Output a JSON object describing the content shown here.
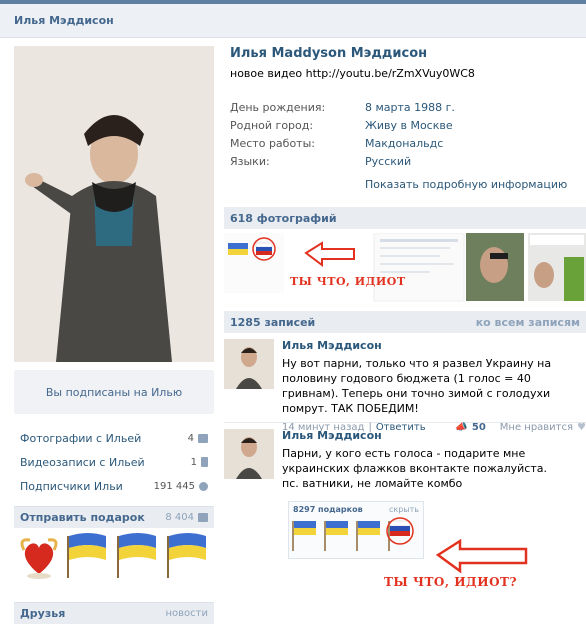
{
  "header": {
    "title": "Илья Мэддисон"
  },
  "profile": {
    "name": "Илья Maddyson Мэддисон",
    "status": "новое видео http://youtu.be/rZmXVuy0WC8",
    "info": [
      {
        "label": "День рождения:",
        "value": "8 марта 1988 г."
      },
      {
        "label": "Родной город:",
        "value": "Живу в Москве"
      },
      {
        "label": "Место работы:",
        "value": "Макдональдс"
      },
      {
        "label": "Языки:",
        "value": "Русский"
      }
    ],
    "show_more": "Показать подробную информацию"
  },
  "left": {
    "subscribed": "Вы подписаны на Илью",
    "links": [
      {
        "label": "Фотографии с Ильей",
        "count": "4"
      },
      {
        "label": "Видеозаписи с Ильей",
        "count": "1"
      },
      {
        "label": "Подписчики Ильи",
        "count": "191 445"
      }
    ],
    "gift_block": {
      "title": "Отправить подарок",
      "count": "8 404"
    },
    "friends": {
      "title": "Друзья",
      "aux": "новости"
    }
  },
  "photos": {
    "title": "618 фотографий",
    "annotation": "ТЫ ЧТО, ИДИОТ"
  },
  "wall": {
    "title": "1285 записей",
    "aux": "ко всем записям",
    "posts": [
      {
        "author": "Илья Мэддисон",
        "text": "Ну вот парни, только что я развел Украину на половину годового бюджета (1 голос = 40 гривнам). Теперь они точно зимой с голодухи помрут. ТАК ПОБЕДИМ!",
        "time": "14 минут назад",
        "reply": "Ответить",
        "likes": "50",
        "like_label": "Мне нравится"
      },
      {
        "author": "Илья Мэддисон",
        "text": "Парни, у кого есть голоса - подарите мне украинских флажков вконтакте пожалуйста.",
        "text2": "пс. ватники, не ломайте комбо",
        "gifts_label": "8297 подарков",
        "gifts_hide": "скрыть",
        "annotation": "ТЫ ЧТО, ИДИОТ?"
      }
    ]
  },
  "colors": {
    "accent": "#45688e",
    "link": "#2b587a",
    "annotation": "#e2321f"
  }
}
